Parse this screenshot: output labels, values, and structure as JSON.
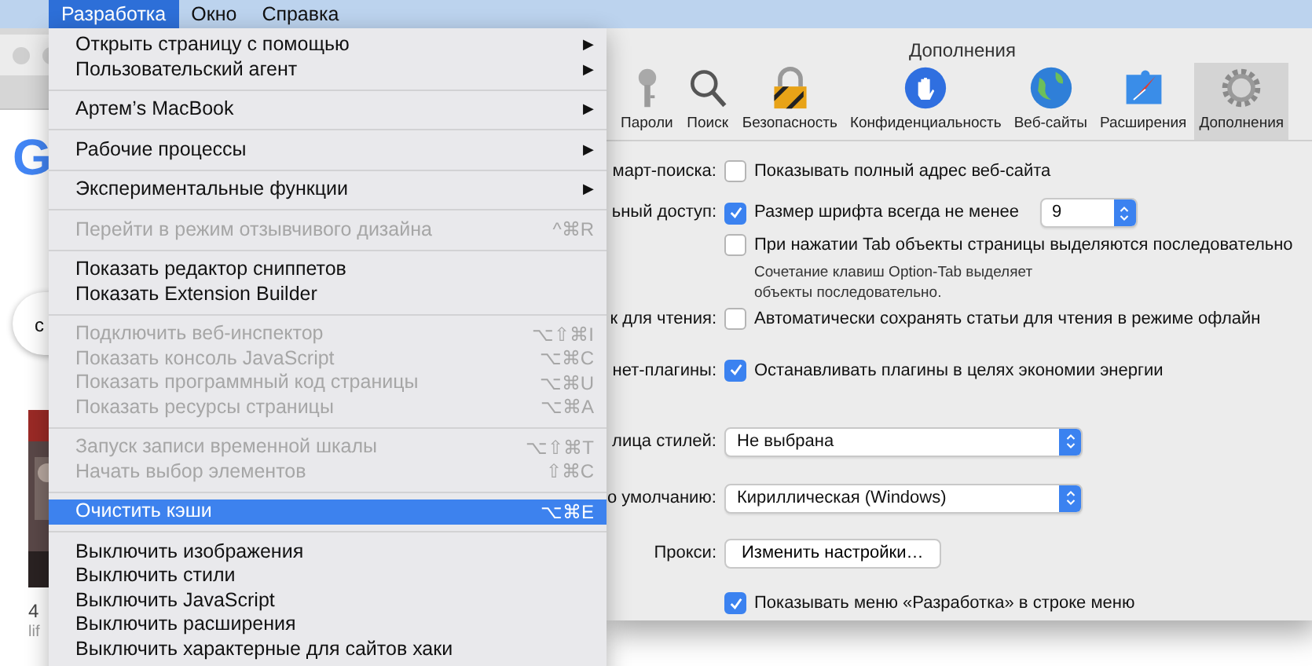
{
  "menubar": {
    "items": [
      {
        "label": "Разработка",
        "selected": true
      },
      {
        "label": "Окно",
        "selected": false
      },
      {
        "label": "Справка",
        "selected": false
      }
    ]
  },
  "browser": {
    "logo": "G",
    "search_text": "с",
    "caption": "4",
    "source": "lif"
  },
  "dev_menu": {
    "groups": [
      [
        {
          "label": "Открыть страницу с помощью",
          "arrow": "▶",
          "disabled": false,
          "selected": false
        },
        {
          "label": "Пользовательский агент",
          "arrow": "▶",
          "disabled": false,
          "selected": false
        }
      ],
      [
        {
          "label": "Артем’s MacBook",
          "arrow": "▶",
          "disabled": false,
          "selected": false
        }
      ],
      [
        {
          "label": "Рабочие процессы",
          "arrow": "▶",
          "disabled": false,
          "selected": false
        }
      ],
      [
        {
          "label": "Экспериментальные функции",
          "arrow": "▶",
          "disabled": false,
          "selected": false
        }
      ],
      [
        {
          "label": "Перейти в режим отзывчивого дизайна",
          "shortcut": "^⌘R",
          "disabled": true,
          "selected": false
        }
      ],
      [
        {
          "label": "Показать редактор сниппетов",
          "disabled": false,
          "selected": false
        },
        {
          "label": "Показать Extension Builder",
          "disabled": false,
          "selected": false
        }
      ],
      [
        {
          "label": "Подключить веб-инспектор",
          "shortcut": "⌥⇧⌘I",
          "disabled": true,
          "selected": false
        },
        {
          "label": "Показать консоль JavaScript",
          "shortcut": "⌥⌘C",
          "disabled": true,
          "selected": false
        },
        {
          "label": "Показать программный код страницы",
          "shortcut": "⌥⌘U",
          "disabled": true,
          "selected": false
        },
        {
          "label": "Показать ресурсы страницы",
          "shortcut": "⌥⌘A",
          "disabled": true,
          "selected": false
        }
      ],
      [
        {
          "label": "Запуск записи временной шкалы",
          "shortcut": "⌥⇧⌘T",
          "disabled": true,
          "selected": false
        },
        {
          "label": "Начать выбор элементов",
          "shortcut": "⇧⌘C",
          "disabled": true,
          "selected": false
        }
      ],
      [
        {
          "label": "Очистить кэши",
          "shortcut": "⌥⌘E",
          "disabled": false,
          "selected": true
        }
      ],
      [
        {
          "label": "Выключить изображения",
          "disabled": false,
          "selected": false
        },
        {
          "label": "Выключить стили",
          "disabled": false,
          "selected": false
        },
        {
          "label": "Выключить JavaScript",
          "disabled": false,
          "selected": false
        },
        {
          "label": "Выключить расширения",
          "disabled": false,
          "selected": false
        },
        {
          "label": "Выключить характерные для сайтов хаки",
          "disabled": false,
          "selected": false
        }
      ]
    ]
  },
  "preferences": {
    "title": "Дополнения",
    "tabs": [
      {
        "label": "Пароли",
        "kind": "key",
        "selected": false
      },
      {
        "label": "Поиск",
        "kind": "search",
        "selected": false
      },
      {
        "label": "Безопасность",
        "kind": "lock",
        "selected": false
      },
      {
        "label": "Конфиденциальность",
        "kind": "hand",
        "selected": false
      },
      {
        "label": "Веб-сайты",
        "kind": "globe",
        "selected": false
      },
      {
        "label": "Расширения",
        "kind": "puzzle",
        "selected": false
      },
      {
        "label": "Дополнения",
        "kind": "gear",
        "selected": true
      }
    ],
    "rows": [
      {
        "kind": "checkbox",
        "label": "март-поиска:",
        "text": "Показывать полный адрес веб-сайта",
        "checked": false
      },
      {
        "kind": "checkbox",
        "label": "ьный доступ:",
        "text": "Размер шрифта всегда не менее",
        "checked": true,
        "value": "9"
      },
      {
        "kind": "checkbox",
        "text": "При нажатии Tab объекты страницы выделяются последовательно",
        "checked": false
      },
      {
        "kind": "note",
        "text": "Сочетание клавиш Option-Tab выделяет объекты последовательно."
      },
      {
        "kind": "checkbox",
        "label": "к для чтения:",
        "text": "Автоматически сохранять статьи для чтения в режиме офлайн",
        "checked": false
      },
      {
        "kind": "checkbox",
        "label": "нет-плагины:",
        "text": "Останавливать плагины в целях экономии энергии",
        "checked": true
      },
      {
        "kind": "select",
        "label": "лица стилей:",
        "value": "Не выбрана"
      },
      {
        "kind": "select",
        "label": "о умолчанию:",
        "value": "Кириллическая (Windows)"
      },
      {
        "kind": "button",
        "label": "Прокси:",
        "text": "Изменить настройки…"
      },
      {
        "kind": "checkbox",
        "text": "Показывать меню «Разработка» в строке меню",
        "checked": true
      }
    ]
  }
}
